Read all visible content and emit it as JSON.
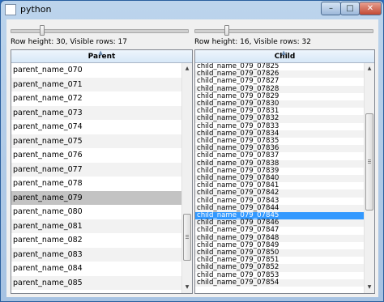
{
  "window": {
    "title": "python",
    "min_label": "–",
    "max_label": "□",
    "close_label": "✕"
  },
  "left": {
    "info": "Row height: 30, Visible rows: 17",
    "header": "Parent",
    "rows": [
      "parent_name_070",
      "parent_name_071",
      "parent_name_072",
      "parent_name_073",
      "parent_name_074",
      "parent_name_075",
      "parent_name_076",
      "parent_name_077",
      "parent_name_078",
      "parent_name_079",
      "parent_name_080",
      "parent_name_081",
      "parent_name_082",
      "parent_name_083",
      "parent_name_084",
      "parent_name_085"
    ],
    "selected_index": 9
  },
  "right": {
    "info": "Row height: 16, Visible rows: 32",
    "header": "Child",
    "rows": [
      "child_name_079_07825",
      "child_name_079_07826",
      "child_name_079_07827",
      "child_name_079_07828",
      "child_name_079_07829",
      "child_name_079_07830",
      "child_name_079_07831",
      "child_name_079_07832",
      "child_name_079_07833",
      "child_name_079_07834",
      "child_name_079_07835",
      "child_name_079_07836",
      "child_name_079_07837",
      "child_name_079_07838",
      "child_name_079_07839",
      "child_name_079_07840",
      "child_name_079_07841",
      "child_name_079_07842",
      "child_name_079_07843",
      "child_name_079_07844",
      "child_name_079_07845",
      "child_name_079_07846",
      "child_name_079_07847",
      "child_name_079_07848",
      "child_name_079_07849",
      "child_name_079_07850",
      "child_name_079_07851",
      "child_name_079_07852",
      "child_name_079_07853",
      "child_name_079_07854"
    ],
    "selected_index": 20
  }
}
